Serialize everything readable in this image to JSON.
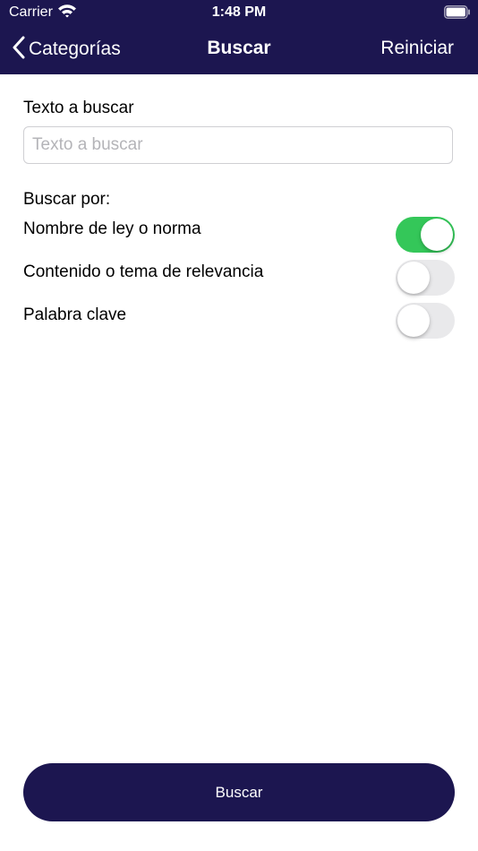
{
  "status_bar": {
    "carrier": "Carrier",
    "time": "1:48 PM"
  },
  "nav": {
    "back_label": "Categorías",
    "title": "Buscar",
    "reset_label": "Reiniciar"
  },
  "search": {
    "label": "Texto a buscar",
    "placeholder": "Texto a buscar",
    "value": ""
  },
  "search_by": {
    "label": "Buscar por:",
    "options": [
      {
        "label": "Nombre de ley o norma",
        "enabled": true
      },
      {
        "label": "Contenido o tema de relevancia",
        "enabled": false
      },
      {
        "label": "Palabra clave",
        "enabled": false
      }
    ]
  },
  "footer": {
    "button_label": "Buscar"
  },
  "colors": {
    "primary": "#1c1650",
    "toggle_on": "#34c759",
    "toggle_off": "#e9e9eb"
  }
}
